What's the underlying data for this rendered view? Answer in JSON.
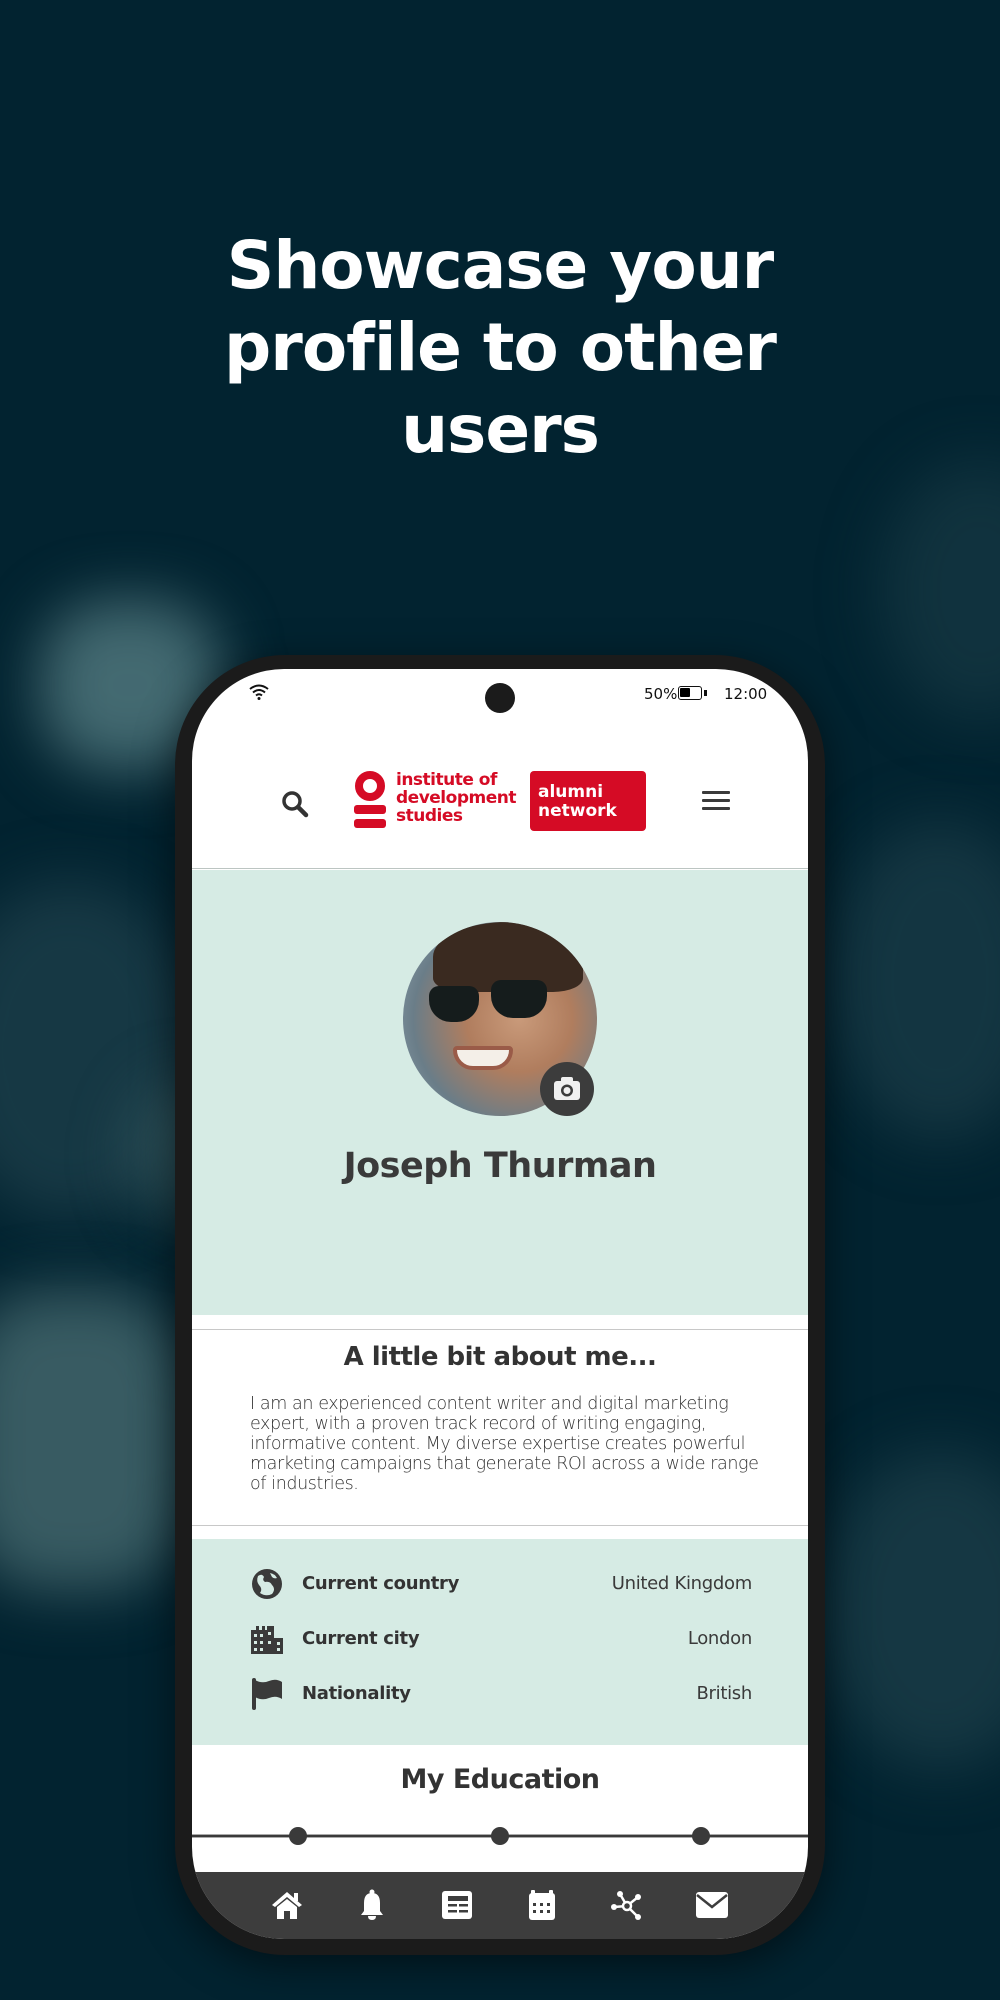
{
  "headline": [
    "Showcase your",
    "profile to other",
    "users"
  ],
  "status_bar": {
    "battery_percent": "50%",
    "time": "12:00",
    "icons": [
      "wifi-icon",
      "battery-icon"
    ]
  },
  "app_bar": {
    "search_icon": "search-icon",
    "logo": {
      "text_lines": [
        "institute of",
        "development",
        "studies"
      ],
      "badge_lines": [
        "alumni",
        "network"
      ],
      "brand_color": "#d50b25"
    },
    "menu_icon": "hamburger-menu-icon"
  },
  "profile": {
    "name": "Joseph Thurman",
    "avatar_alt": "Profile photo of Joseph Thurman",
    "camera_icon": "camera-icon",
    "hero_background": "#d6ebe4"
  },
  "about": {
    "title": "A little bit about me...",
    "text": "I am an experienced content writer and digital marketing expert, with a proven track record of writing engaging, informative content. My diverse expertise creates powerful marketing campaigns that generate ROI across a wide range of industries."
  },
  "details": [
    {
      "icon": "globe-icon",
      "label": "Current country",
      "value": "United Kingdom"
    },
    {
      "icon": "city-icon",
      "label": "Current city",
      "value": "London"
    },
    {
      "icon": "flag-icon",
      "label": "Nationality",
      "value": "British"
    }
  ],
  "education": {
    "title": "My Education",
    "timeline_points": 3
  },
  "bottom_nav": [
    {
      "icon": "home-icon",
      "label": "Home"
    },
    {
      "icon": "bell-icon",
      "label": "Notifications"
    },
    {
      "icon": "news-icon",
      "label": "News"
    },
    {
      "icon": "calendar-icon",
      "label": "Events"
    },
    {
      "icon": "network-icon",
      "label": "Network"
    },
    {
      "icon": "mail-icon",
      "label": "Messages"
    }
  ],
  "colors": {
    "page_background": "#022330",
    "text_dark": "#333333",
    "nav_background": "#3d3d3d"
  }
}
